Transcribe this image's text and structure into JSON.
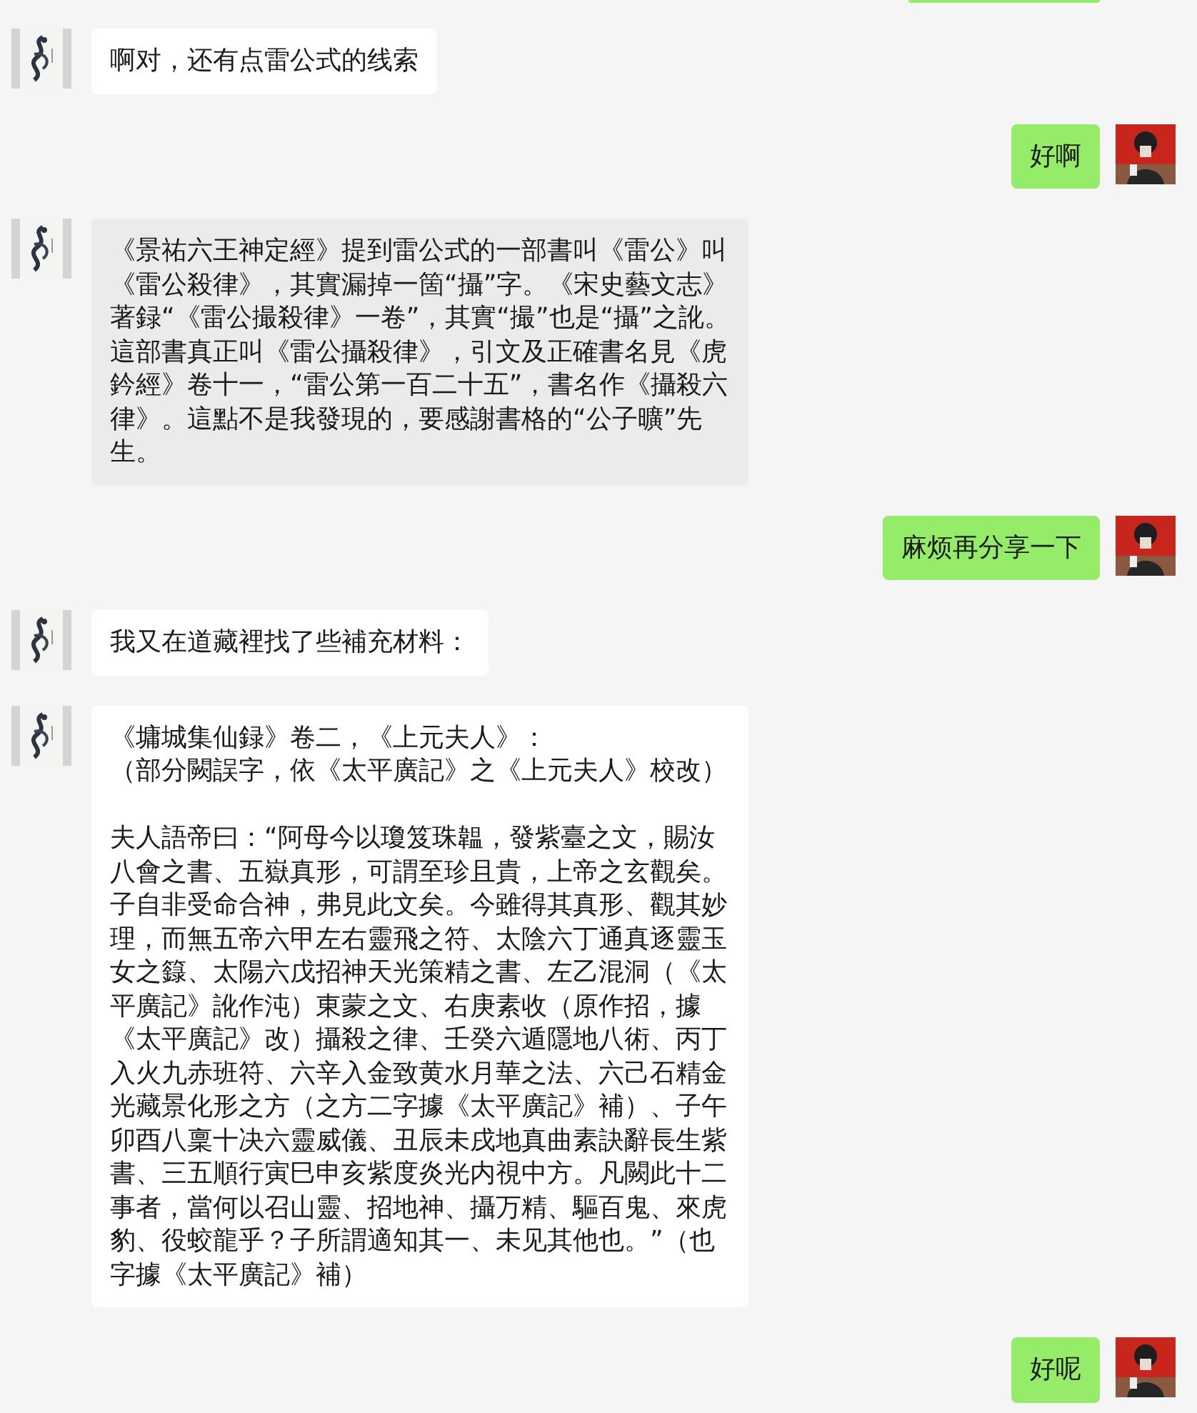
{
  "messages": [
    {
      "kind": "sent_partial"
    },
    {
      "kind": "received",
      "text": "啊对，还有点雷公式的线索"
    },
    {
      "kind": "sent",
      "text": "好啊"
    },
    {
      "kind": "received",
      "selected": true,
      "text": "《景祐六王神定經》提到雷公式的一部書叫《雷公》叫《雷公殺律》，其實漏掉一箇“攝”字。《宋史藝文志》著録“《雷公撮殺律》一卷”，其實“撮”也是“攝”之訛。這部書真正叫《雷公攝殺律》，引文及正確書名見《虎鈐經》卷十一，“雷公第一百二十五”，書名作《攝殺六律》。這點不是我發現的，要感謝書格的“公子曠”先生。"
    },
    {
      "kind": "sent",
      "text": "麻烦再分享一下"
    },
    {
      "kind": "received",
      "text": "我又在道藏裡找了些補充材料："
    },
    {
      "kind": "received",
      "selected": false,
      "heading_lines": [
        "《墉城集仙録》卷二，《上元夫人》：",
        "（部分闕誤字，依《太平廣記》之《上元夫人》校改）"
      ],
      "text": "夫人語帝曰：“阿母今以瓊笈珠韞，發紫臺之文，賜汝八會之書、五嶽真形，可謂至珍且貴，上帝之玄觀矣。子自非受命合神，弗見此文矣。今雖得其真形、觀其妙理，而無五帝六甲左右靈飛之符、太陰六丁通真逐靈玉女之籙、太陽六戊招神天光策精之書、左乙混洞（《太平廣記》訛作沌）東蒙之文、右庚素收（原作招，據《太平廣記》改）攝殺之律、壬癸六遁隱地八術、丙丁入火九赤班符、六辛入金致黄水月華之法、六己石精金光藏景化形之方（之方二字據《太平廣記》補）、子午卯酉八稟十决六靈威儀、丑辰未戌地真曲素訣辭長生紫書、三五順行寅巳申亥紫度炎光内視中方。凡闕此十二事者，當何以召山靈、招地神、攝万精、驅百鬼、來虎豹、役蛟龍乎？子所謂適知其一、未见其他也。”（也字據《太平廣記》補）"
    },
    {
      "kind": "sent",
      "text": "好呢"
    }
  ]
}
